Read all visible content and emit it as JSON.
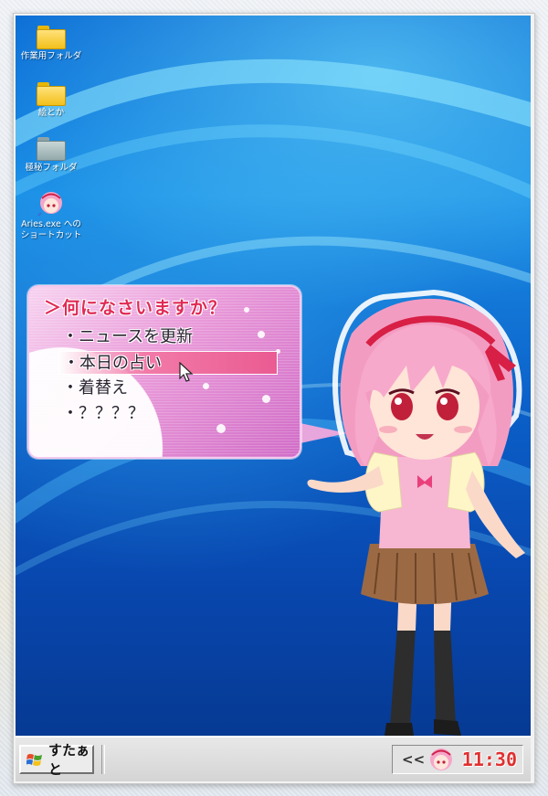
{
  "desktop": {
    "icons": [
      {
        "label": "作業用フォルダ",
        "type": "folder"
      },
      {
        "label": "絵とか",
        "type": "folder"
      },
      {
        "label": "極秘フォルダ",
        "type": "folder-gray"
      },
      {
        "label_line1": "Aries.exe への",
        "label_line2": "ショートカット",
        "type": "shortcut"
      }
    ]
  },
  "bubble": {
    "prompt": "＞何になさいますか？",
    "items": [
      {
        "label": "・ニュースを更新"
      },
      {
        "label": "・本日の占い",
        "selected": true
      },
      {
        "label": "・着替え"
      },
      {
        "label": "・？？？？"
      }
    ]
  },
  "taskbar": {
    "start_label": "すたぁと",
    "tray_chevron": "<<",
    "clock": "11:30"
  },
  "colors": {
    "desktop_blue": "#0b5fc8",
    "menu_highlight": "#ea5b92",
    "clock_red": "#e0302f",
    "prompt_red": "#e02a55"
  }
}
